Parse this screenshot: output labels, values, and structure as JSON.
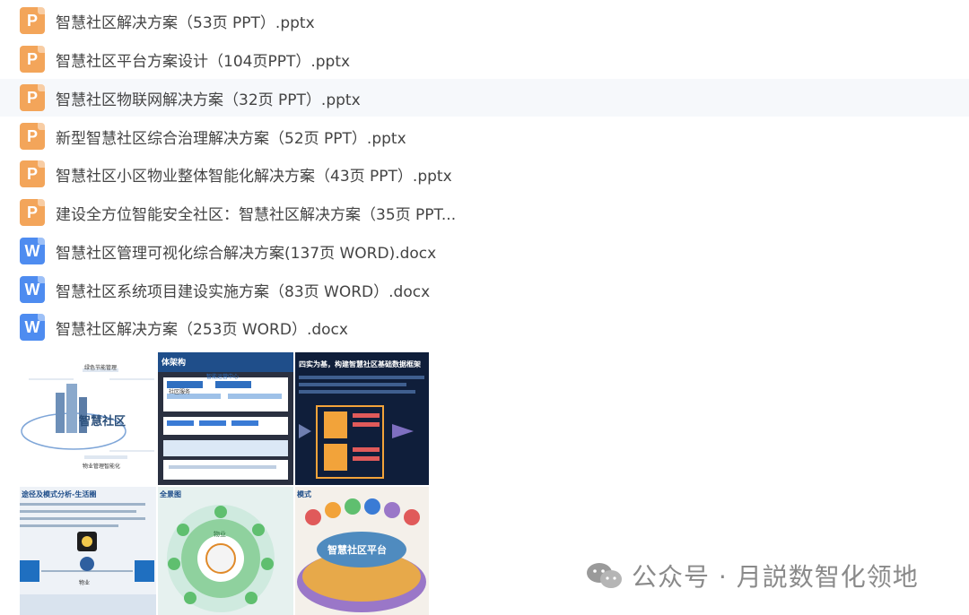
{
  "files": [
    {
      "type": "ppt",
      "icon_letter": "P",
      "name": "智慧社区解决方案（53页 PPT）.pptx"
    },
    {
      "type": "ppt",
      "icon_letter": "P",
      "name": "智慧社区平台方案设计（104页PPT）.pptx"
    },
    {
      "type": "ppt",
      "icon_letter": "P",
      "name": "智慧社区物联网解决方案（32页 PPT）.pptx"
    },
    {
      "type": "ppt",
      "icon_letter": "P",
      "name": "新型智慧社区综合治理解决方案（52页 PPT）.pptx"
    },
    {
      "type": "ppt",
      "icon_letter": "P",
      "name": "智慧社区小区物业整体智能化解决方案（43页 PPT）.pptx"
    },
    {
      "type": "ppt",
      "icon_letter": "P",
      "name": "建设全方位智能安全社区：智慧社区解决方案（35页 PPT..."
    },
    {
      "type": "doc",
      "icon_letter": "W",
      "name": "智慧社区管理可视化综合解决方案(137页 WORD).docx"
    },
    {
      "type": "doc",
      "icon_letter": "W",
      "name": "智慧社区系统项目建设实施方案（83页 WORD）.docx"
    },
    {
      "type": "doc",
      "icon_letter": "W",
      "name": "智慧社区解决方案（253页 WORD）.docx"
    }
  ],
  "thumbnails": {
    "t1": {
      "title": "智慧社区",
      "label_a": "绿色节能管理",
      "label_b": "物业管理智能化"
    },
    "t2": {
      "title": "体架构",
      "label_a": "智能运营中心",
      "label_b": "社区服务"
    },
    "t3": {
      "title": "四实为基，构建智慧社区基础数据框架"
    },
    "t4": {
      "title": "途径及模式分析-生活圈",
      "label_a": "物业"
    },
    "t5": {
      "title": "全景图",
      "label_a": "物业"
    },
    "t6": {
      "title": "模式",
      "label_a": "智慧社区平台"
    }
  },
  "watermark": {
    "text": "公众号 · 月説数智化领地"
  },
  "colors": {
    "ppt": "#f3a55a",
    "doc": "#4e8cf0",
    "hover_row": "#f6f8fb"
  }
}
